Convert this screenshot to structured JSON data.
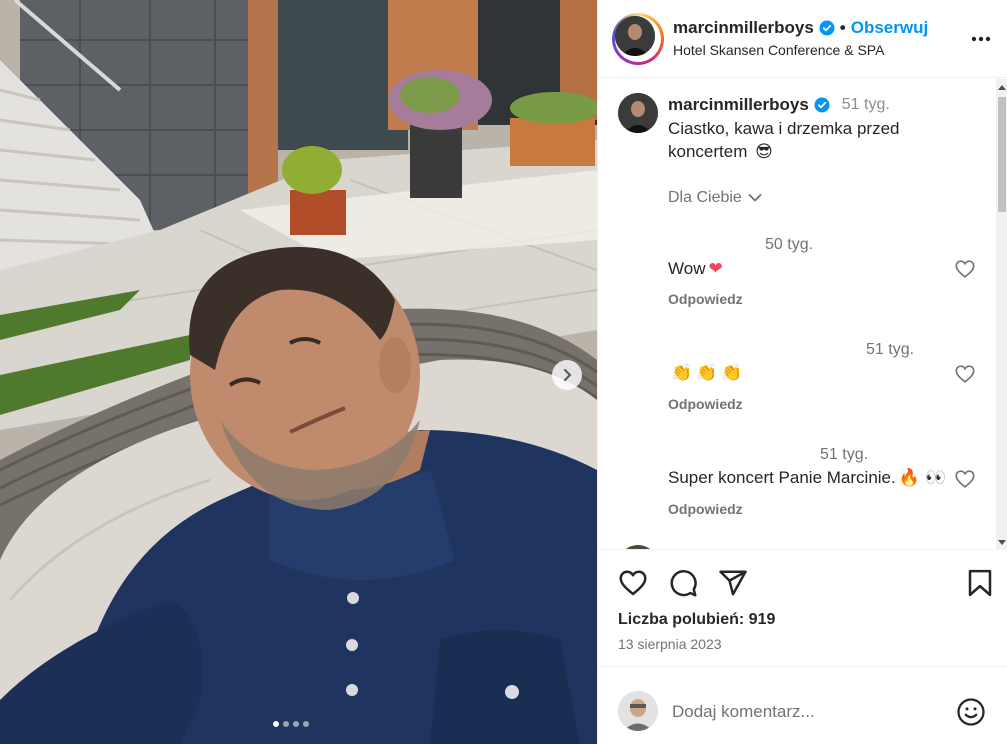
{
  "post": {
    "username": "marcinmillerboys",
    "follow_label": "Obserwuj",
    "location": "Hotel Skansen Conference & SPA",
    "separator": "•",
    "caption": {
      "username": "marcinmillerboys",
      "time": "51 tyg.",
      "text": "Ciastko, kawa i drzemka przed koncertem",
      "emoji": "😎"
    },
    "filter_label": "Dla Ciebie",
    "comments": [
      {
        "time": "50 tyg.",
        "text": "Wow",
        "emoji": "❤",
        "reply_label": "Odpowiedz"
      },
      {
        "time": "51 tyg.",
        "text": "",
        "emoji": "👏👏👏",
        "reply_label": "Odpowiedz"
      },
      {
        "time": "51 tyg.",
        "text": "Super koncert Panie Marcinie.",
        "emoji": "🔥 👀",
        "reply_label": "Odpowiedz"
      }
    ],
    "likes_text": "Liczba polubień: 919",
    "date": "13 sierpnia 2023",
    "comment_placeholder": "Dodaj komentarz...",
    "carousel": {
      "total": 4,
      "active_index": 0
    }
  },
  "colors": {
    "accent_blue": "#0095f6",
    "verified_blue": "#0095f6",
    "heart_red": "#ed4956",
    "secondary_text": "#737373"
  },
  "icons": [
    "verified-badge-icon",
    "more-options-icon",
    "chevron-down-icon",
    "heart-icon",
    "comment-icon",
    "share-icon",
    "bookmark-icon",
    "emoji-icon",
    "chevron-right-icon"
  ]
}
